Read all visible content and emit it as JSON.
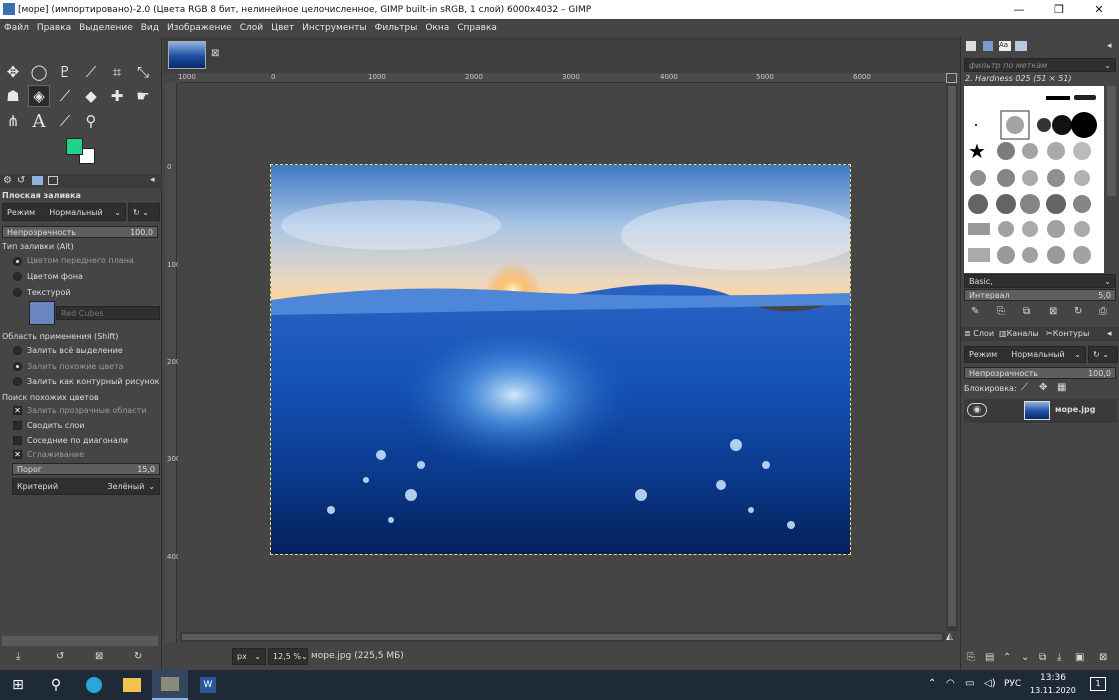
{
  "window": {
    "title": "[море] (импортировано)-2.0 (Цвета RGB 8 бит, нелинейное целочисленное, GIMP built-in sRGB, 1 слой) 6000x4032 – GIMP",
    "min_icon": "minimize-icon",
    "max_icon": "maximize-icon",
    "close_icon": "close-icon"
  },
  "menu": [
    "Файл",
    "Правка",
    "Выделение",
    "Вид",
    "Изображение",
    "Слой",
    "Цвет",
    "Инструменты",
    "Фильтры",
    "Окна",
    "Справка"
  ],
  "toolbox": {
    "tools": [
      "move-tool-icon",
      "ellipse-select-icon",
      "lasso-icon",
      "fuzzy-select-icon",
      "crop-icon",
      "transform-icon",
      "warp-icon",
      "bucket-fill-icon",
      "paintbrush-icon",
      "eraser-icon",
      "heal-icon",
      "smudge-icon",
      "path-icon",
      "text-tool-icon",
      "color-picker-icon",
      "zoom-icon"
    ],
    "fg_color": "#1fd38a",
    "bg_color": "#ffffff"
  },
  "tool_options": {
    "title": "Плоская заливка",
    "mode_label": "Режим",
    "mode_value": "Нормальный",
    "opacity_label": "Непрозрачность",
    "opacity_value": "100,0",
    "fill_type_label": "Тип заливки (Alt)",
    "fill_types": [
      "Цветом переднего плана",
      "Цветом фона",
      "Текстурой"
    ],
    "pattern_name": "Red Cubes",
    "area_label": "Область применения (Shift)",
    "areas": [
      "Залить всё выделение",
      "Залить похожие цвета",
      "Залить как контурный рисунок"
    ],
    "similar_label": "Поиск похожих цветов",
    "similar_opts": [
      "Залить прозрачные области",
      "Сводить слои",
      "Соседние по диагонали",
      "Сглаживание"
    ],
    "threshold_label": "Порог",
    "threshold_value": "15,0",
    "criterion_label": "Критерий",
    "criterion_value": "Зелёный"
  },
  "rulers": {
    "h": [
      "1000",
      "0",
      "1000",
      "2000",
      "3000",
      "4000",
      "5000",
      "6000"
    ],
    "v": [
      "0",
      "1000",
      "2000",
      "3000",
      "4000"
    ]
  },
  "status": {
    "unit": "px",
    "zoom": "12,5 %",
    "file_info": "море.jpg (225,5 МБ)"
  },
  "right_dock": {
    "filter_placeholder": "фильтр по меткам",
    "brush_name": "2. Hardness 025 (51 × 51)",
    "brush_set": "Basic,",
    "spacing_label": "Интервал",
    "spacing_value": "5,0",
    "tabs": [
      "Слои",
      "Каналы",
      "Контуры"
    ],
    "mode_label": "Режим",
    "mode_value": "Нормальный",
    "opacity_label": "Непрозрачность",
    "opacity_value": "100,0",
    "lock_label": "Блокировка:",
    "layer_name": "море.jpg"
  },
  "taskbar": {
    "lang": "РУС",
    "time": "13:36",
    "date": "13.11.2020",
    "notif_count": "1"
  }
}
